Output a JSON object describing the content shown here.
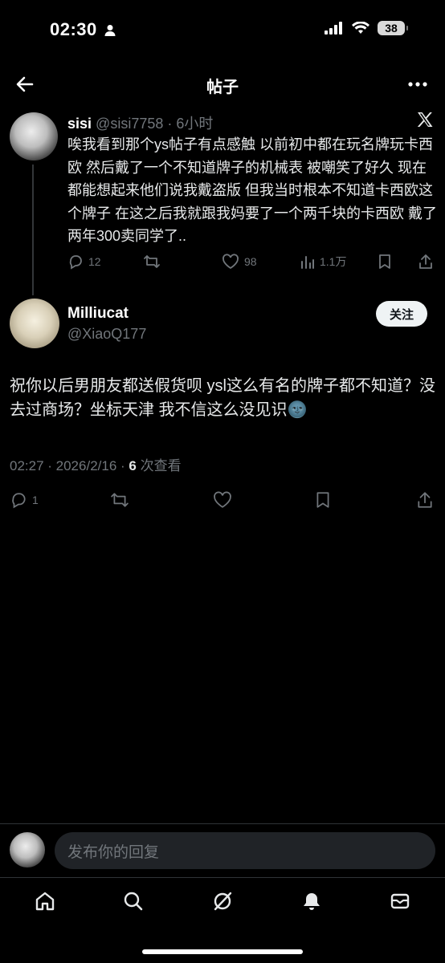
{
  "status_bar": {
    "time": "02:30",
    "battery": "38"
  },
  "header": {
    "title": "帖子"
  },
  "parent_tweet": {
    "name": "sisi",
    "handle": "@sisi7758",
    "time": "· 6小时",
    "text": "唉我看到那个ys帖子有点感触 以前初中都在玩名牌玩卡西欧 然后戴了一个不知道牌子的机械表 被嘲笑了好久 现在都能想起来他们说我戴盗版 但我当时根本不知道卡西欧这个牌子 在这之后我就跟我妈要了一个两千块的卡西欧 戴了两年300卖同学了..",
    "replies": "12",
    "likes": "98",
    "views": "1.1万"
  },
  "main_tweet": {
    "name": "Milliucat",
    "handle": "@XiaoQ177",
    "follow_label": "关注",
    "text": "祝你以后男朋友都送假货呗 ysl这么有名的牌子都不知道？没去过商场？坐标天津 我不信这么没见识",
    "emoji": "🌚",
    "timestamp": "02:27 · 2026/2/16 · ",
    "view_count": "6",
    "view_label": " 次查看",
    "replies": "1"
  },
  "reply_box": {
    "placeholder": "发布你的回复"
  },
  "tabs": [
    "home",
    "search",
    "grok",
    "notifications",
    "messages"
  ],
  "colors": {
    "background": "#000000",
    "text": "#e7e9ea",
    "muted": "#71767b",
    "follow_bg": "#eff3f4"
  }
}
